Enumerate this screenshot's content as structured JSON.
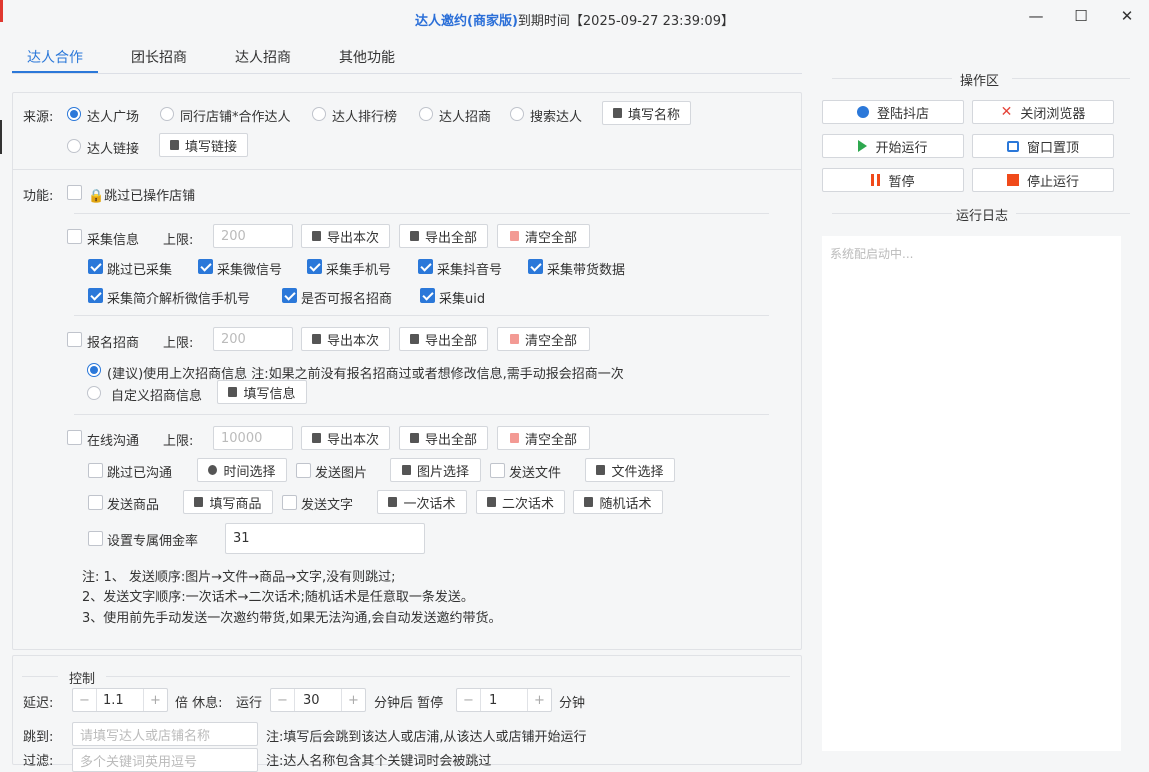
{
  "window": {
    "title_brand": "达人邀约(商家版)",
    "title_rest": "到期时间【2025-09-27 23:39:09】",
    "min": "—",
    "max": "☐",
    "close": "✕"
  },
  "tabs": [
    "达人合作",
    "团长招商",
    "达人招商",
    "其他功能"
  ],
  "source": {
    "label": "来源:",
    "options": [
      "达人广场",
      "同行店铺*合作达人",
      "达人排行榜",
      "达人招商",
      "搜索达人",
      "达人链接"
    ],
    "selected": "达人广场",
    "fill_name_btn": "填写名称",
    "fill_link_btn": "填写链接"
  },
  "func": {
    "label": "功能:",
    "skip_store": "🔒跳过已操作店铺"
  },
  "collect": {
    "label": "采集信息",
    "limit_label": "上限:",
    "limit_placeholder": "200",
    "export_this": "导出本次",
    "export_all": "导出全部",
    "clear_all": "清空全部",
    "opts": [
      {
        "label": "跳过已采集",
        "checked": true
      },
      {
        "label": "采集微信号",
        "checked": true
      },
      {
        "label": "采集手机号",
        "checked": true
      },
      {
        "label": "采集抖音号",
        "checked": true
      },
      {
        "label": "采集带货数据",
        "checked": true
      },
      {
        "label": "采集简介解析微信手机号",
        "checked": true
      },
      {
        "label": "是否可报名招商",
        "checked": true
      },
      {
        "label": "采集uid",
        "checked": true
      }
    ]
  },
  "enroll": {
    "label": "报名招商",
    "limit_label": "上限:",
    "limit_placeholder": "200",
    "export_this": "导出本次",
    "export_all": "导出全部",
    "clear_all": "清空全部",
    "opt1": "(建议)使用上次招商信息 注:如果之前没有报名招商过或者想修改信息,需手动报会招商一次",
    "opt2": "自定义招商信息",
    "fill_info": "填写信息"
  },
  "chat": {
    "label": "在线沟通",
    "limit_label": "上限:",
    "limit_placeholder": "10000",
    "export_this": "导出本次",
    "export_all": "导出全部",
    "clear_all": "清空全部",
    "skip": "跳过已沟通",
    "time_btn": "时间选择",
    "send_img": "发送图片",
    "img_btn": "图片选择",
    "send_file": "发送文件",
    "file_btn": "文件选择",
    "send_goods": "发送商品",
    "goods_btn": "填写商品",
    "send_text": "发送文字",
    "script1": "一次话术",
    "script2": "二次话术",
    "script_rand": "随机话术",
    "commission": "设置专属佣金率",
    "commission_value": "31",
    "notes": [
      "注: 1、 发送顺序:图片→文件→商品→文字,没有则跳过;",
      "2、发送文字顺序:一次话术→二次话术;随机话术是任意取一条发送。",
      "3、使用前先手动发送一次邀约带货,如果无法沟通,会自动发送邀约带货。"
    ]
  },
  "control": {
    "title": "控制",
    "delay_label": "延迟:",
    "delay": "1.1",
    "times_rest": "倍 休息:",
    "run_label": "运行",
    "run_minutes": "30",
    "after_pause": "分钟后 暂停",
    "pause_minutes": "1",
    "minute": "分钟",
    "jump_label": "跳到:",
    "jump_placeholder": "请填写达人或店铺名称",
    "jump_note": "注:填写后会跳到该达人或店浦,从该达人或店铺开始运行",
    "filter_label": "过滤:",
    "filter_placeholder": "多个关键词英用逗号",
    "filter_note": "注:达人名称包含其个关键词时会被跳过"
  },
  "ops": {
    "title": "操作区",
    "login": "登陆抖店",
    "close_browser": "关闭浏览器",
    "start": "开始运行",
    "pin": "窗口置顶",
    "pause": "暂停",
    "stop": "停止运行"
  },
  "log": {
    "title": "运行日志",
    "placeholder": "系统配启动中..."
  },
  "colors": {
    "accent": "#2b78d9",
    "start": "#2ea84f",
    "stop": "#f04a1a",
    "close": "#e5453a"
  }
}
